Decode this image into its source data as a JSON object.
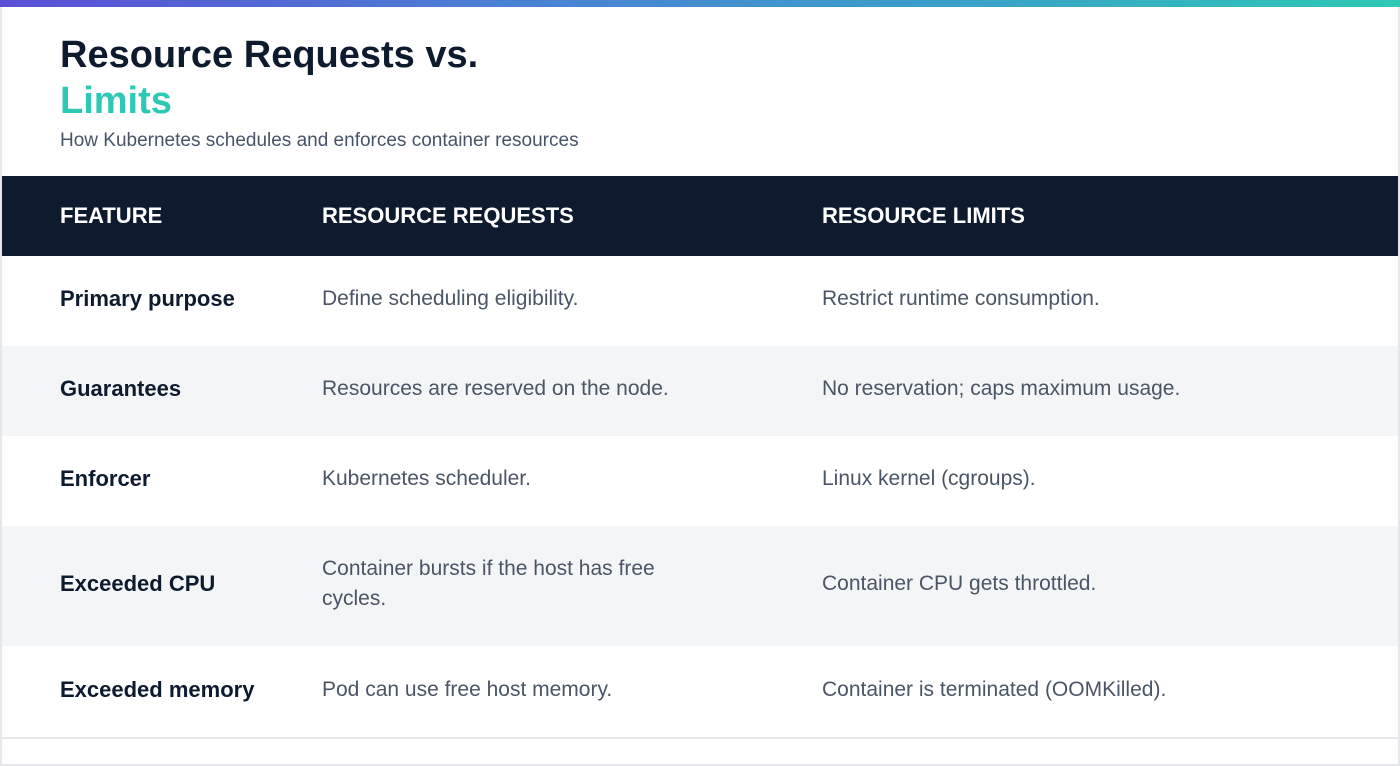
{
  "header": {
    "title_main": "Resource Requests vs.",
    "title_accent": "Limits",
    "subtitle": "How Kubernetes schedules and enforces container resources"
  },
  "table": {
    "columns": [
      "FEATURE",
      "RESOURCE REQUESTS",
      "RESOURCE LIMITS"
    ],
    "rows": [
      {
        "feature": "Primary purpose",
        "requests": "Define scheduling eligibility.",
        "limits": "Restrict runtime consumption."
      },
      {
        "feature": "Guarantees",
        "requests": "Resources are reserved on the node.",
        "limits": "No reservation; caps maximum usage."
      },
      {
        "feature": "Enforcer",
        "requests": "Kubernetes scheduler.",
        "limits": "Linux kernel (cgroups)."
      },
      {
        "feature": "Exceeded CPU",
        "requests": "Container bursts if the host has free cycles.",
        "limits": "Container CPU gets throttled."
      },
      {
        "feature": "Exceeded memory",
        "requests": "Pod can use free host memory.",
        "limits": "Container is terminated (OOMKilled)."
      }
    ]
  },
  "colors": {
    "accent": "#2ec9b4",
    "header_bg": "#0e1b2e",
    "stripe": "#f4f5f7"
  }
}
